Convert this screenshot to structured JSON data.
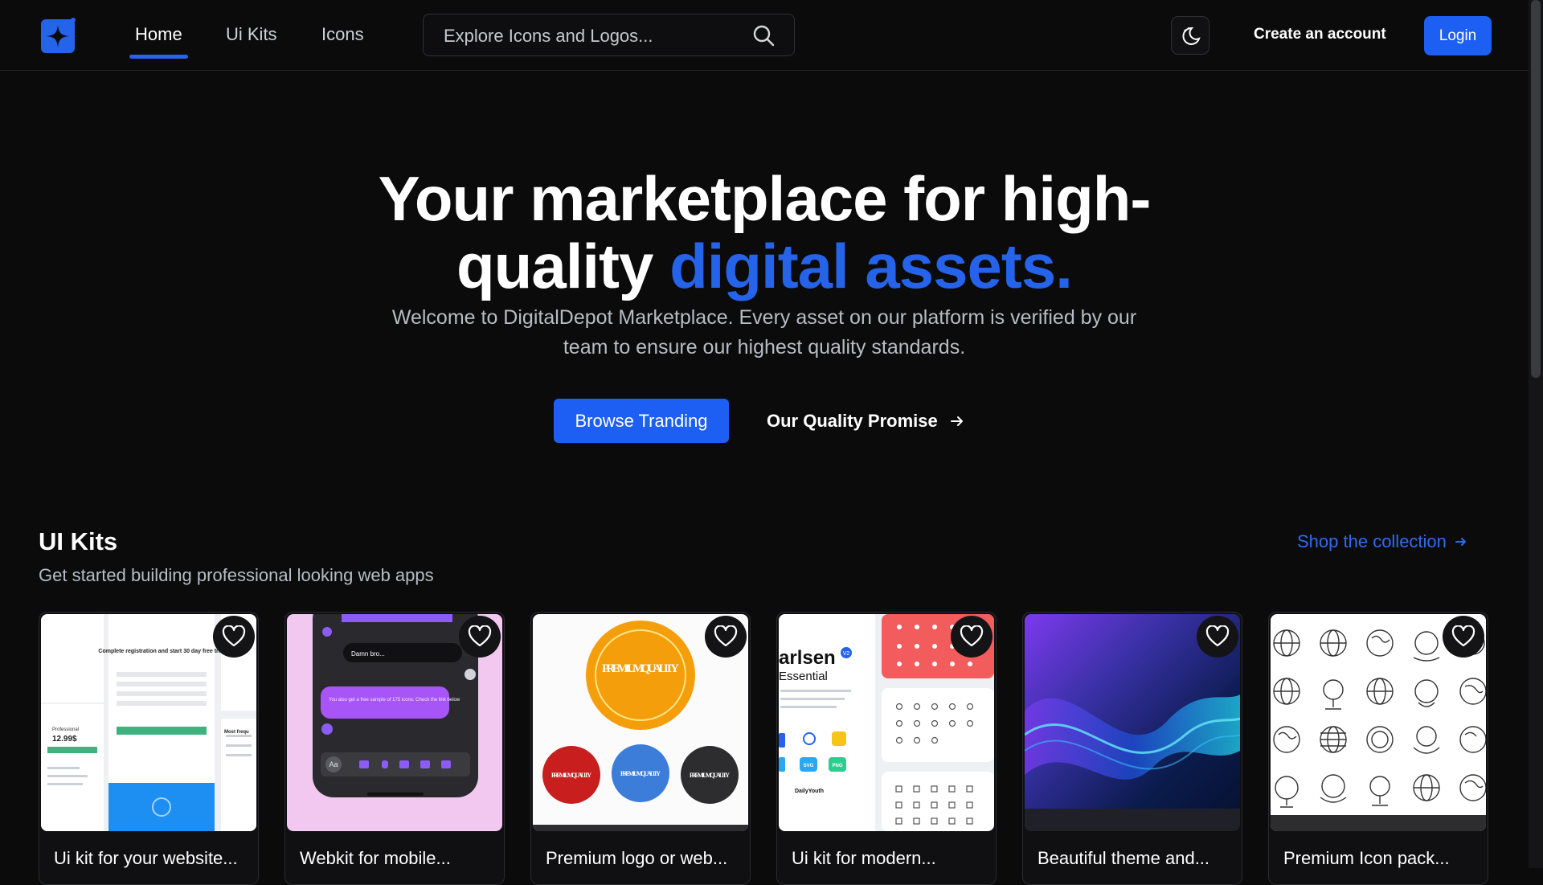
{
  "nav": {
    "items": [
      {
        "label": "Home",
        "active": true
      },
      {
        "label": "Ui Kits",
        "active": false
      },
      {
        "label": "Icons",
        "active": false
      }
    ]
  },
  "search": {
    "placeholder": "Explore Icons and Logos..."
  },
  "header": {
    "create_account": "Create an account",
    "login": "Login"
  },
  "hero": {
    "title_line1": "Your marketplace for high-",
    "title_line2_plain": "quality ",
    "title_line2_accent": "digital assets.",
    "subtitle": "Welcome to DigitalDepot Marketplace. Every asset on our platform is verified by our team to ensure our highest quality standards.",
    "primary_cta": "Browse Tranding",
    "secondary_cta": "Our Quality Promise"
  },
  "section": {
    "title": "UI Kits",
    "subtitle": "Get started building professional looking web apps",
    "link": "Shop the collection"
  },
  "cards": [
    {
      "title": "Ui kit for your website...",
      "thumb": "ui-kit-website"
    },
    {
      "title": "Webkit for mobile...",
      "thumb": "mobile-chat"
    },
    {
      "title": "Premium logo or web...",
      "thumb": "premium-badges"
    },
    {
      "title": "Ui kit for modern...",
      "thumb": "essential-icons"
    },
    {
      "title": "Beautiful theme and...",
      "thumb": "blue-wave"
    },
    {
      "title": "Premium Icon pack...",
      "thumb": "globe-icons"
    }
  ],
  "thumb_text": {
    "card1": {
      "heading": "Complete registration and start 30 day free trial",
      "plan": "Professional",
      "price": "12.99$",
      "most": "Most frequ"
    },
    "card2": {
      "msg1": "Damn bro...",
      "msg2": "You also get a free sample of 175 icons. Check the link below",
      "aa": "Aa"
    },
    "card3": {
      "badge_big": "PREMIUM QUALITY",
      "badge_small": "PREMIUM QUALITY"
    },
    "card4": {
      "brand": "arlsen",
      "version": "V2",
      "sub": "Essential",
      "author": "DailyYouth",
      "svg": "SVG",
      "png": "PNG"
    }
  },
  "colors": {
    "accent": "#2563eb",
    "background": "#0b0b0c",
    "button": "#1d5ff2"
  }
}
